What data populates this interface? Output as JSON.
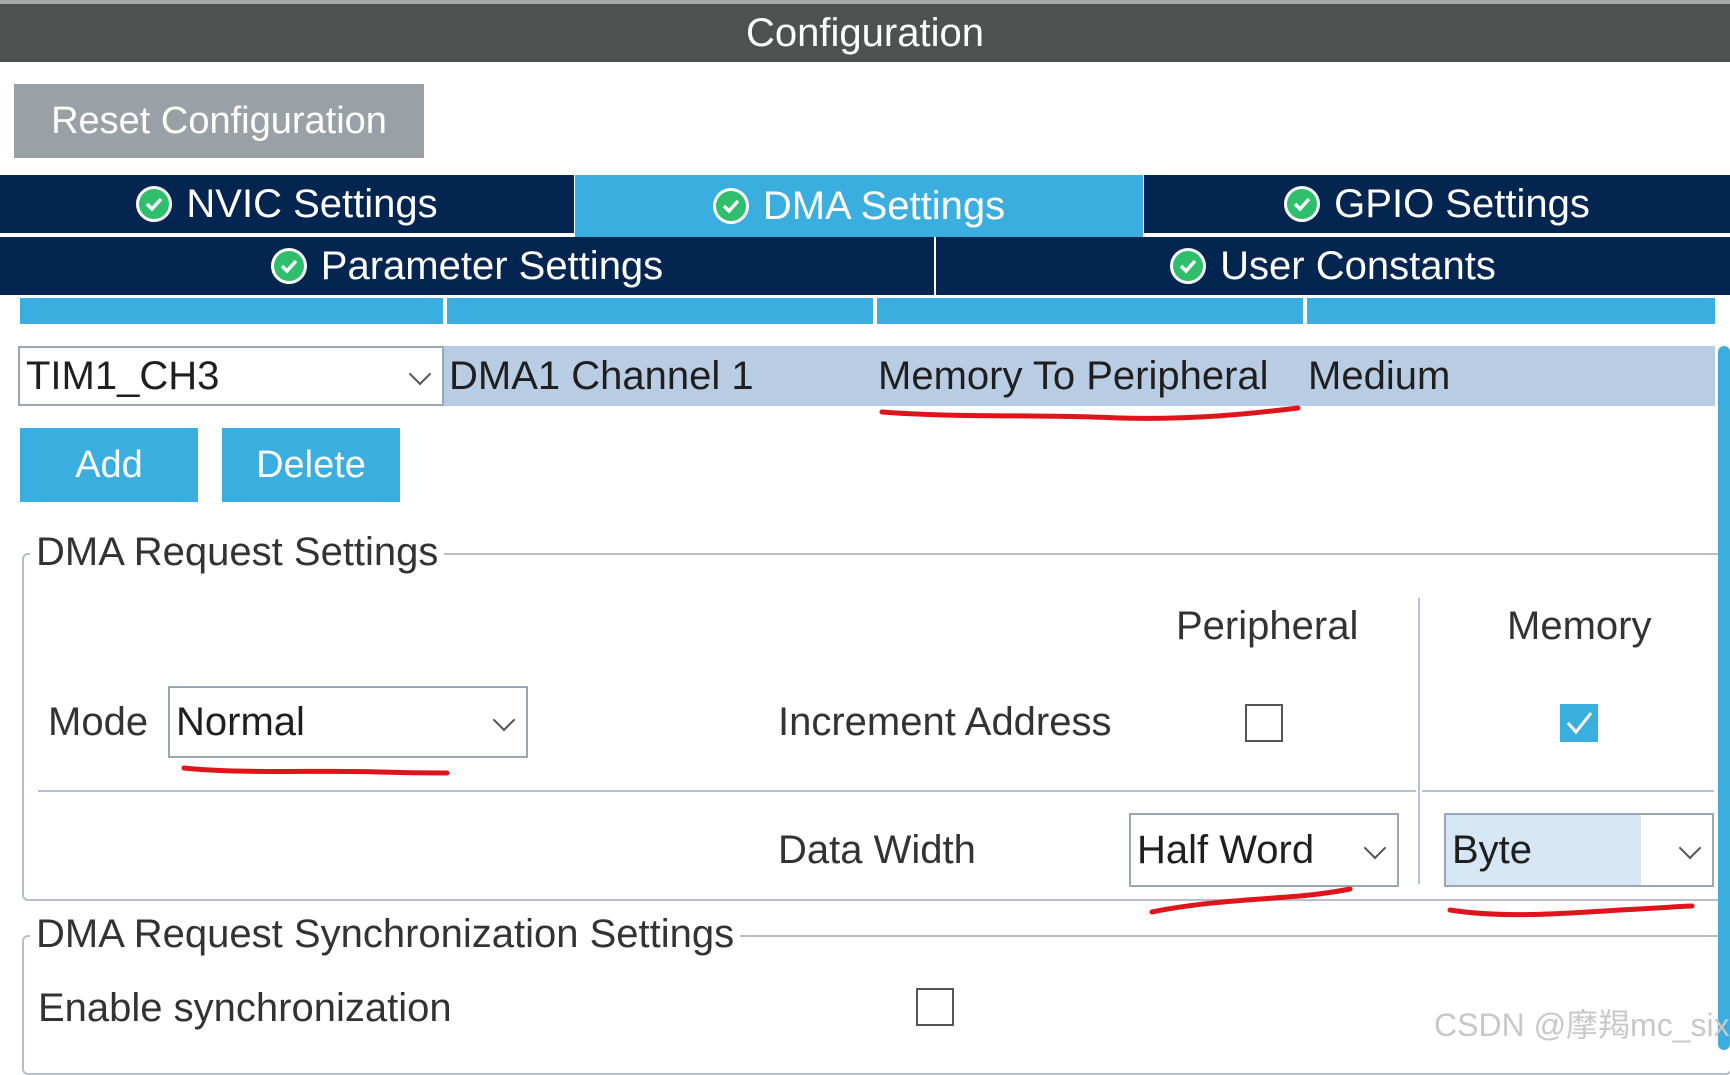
{
  "window": {
    "title": "Configuration"
  },
  "toolbar": {
    "reset_label": "Reset Configuration"
  },
  "tabs": [
    {
      "label": "NVIC Settings",
      "active": false
    },
    {
      "label": "DMA Settings",
      "active": true
    },
    {
      "label": "GPIO Settings",
      "active": false
    },
    {
      "label": "Parameter Settings",
      "active": false
    },
    {
      "label": "User Constants",
      "active": false
    }
  ],
  "dma_table": {
    "row": {
      "request": "TIM1_CH3",
      "channel": "DMA1 Channel 1",
      "direction": "Memory To Peripheral",
      "priority": "Medium"
    }
  },
  "actions": {
    "add_label": "Add",
    "delete_label": "Delete"
  },
  "request_settings": {
    "legend": "DMA Request Settings",
    "mode_label": "Mode",
    "mode_value": "Normal",
    "peripheral_header": "Peripheral",
    "memory_header": "Memory",
    "increment_label": "Increment Address",
    "increment_peripheral": false,
    "increment_memory": true,
    "data_width_label": "Data Width",
    "data_width_peripheral": "Half Word",
    "data_width_memory": "Byte"
  },
  "sync_settings": {
    "legend": "DMA Request Synchronization Settings",
    "enable_label": "Enable synchronization",
    "enabled": false
  },
  "watermark": "CSDN @摩羯mc_six",
  "colors": {
    "accent": "#3baee0",
    "tab_bg": "#04254f",
    "annotation": "#e0141b"
  }
}
